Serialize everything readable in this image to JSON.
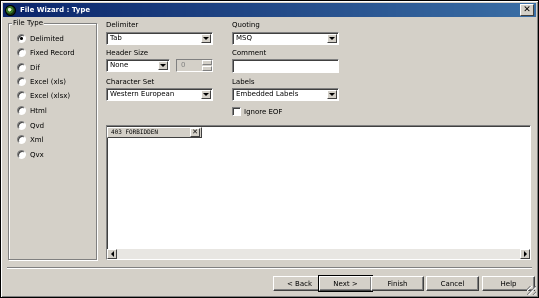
{
  "window": {
    "title": "File Wizard : Type",
    "close_symbol": "✕"
  },
  "file_type": {
    "title": "File Type",
    "selected": "Delimited",
    "options": [
      "Delimited",
      "Fixed Record",
      "Dif",
      "Excel (xls)",
      "Excel (xlsx)",
      "Html",
      "Qvd",
      "Xml",
      "Qvx"
    ]
  },
  "delimiter": {
    "label": "Delimiter",
    "value": "Tab"
  },
  "header_size": {
    "label": "Header Size",
    "value": "None",
    "number": "0"
  },
  "character_set": {
    "label": "Character Set",
    "value": "Western European"
  },
  "quoting": {
    "label": "Quoting",
    "value": "MSQ"
  },
  "comment": {
    "label": "Comment",
    "value": ""
  },
  "labels": {
    "label": "Labels",
    "value": "Embedded Labels"
  },
  "ignore_eof": {
    "label": "Ignore EOF",
    "checked": false
  },
  "preview": {
    "column_header": "403 FORBIDDEN",
    "column_close": "✕"
  },
  "buttons": {
    "back": "< Back",
    "next": "Next >",
    "finish": "Finish",
    "cancel": "Cancel",
    "help": "Help"
  }
}
